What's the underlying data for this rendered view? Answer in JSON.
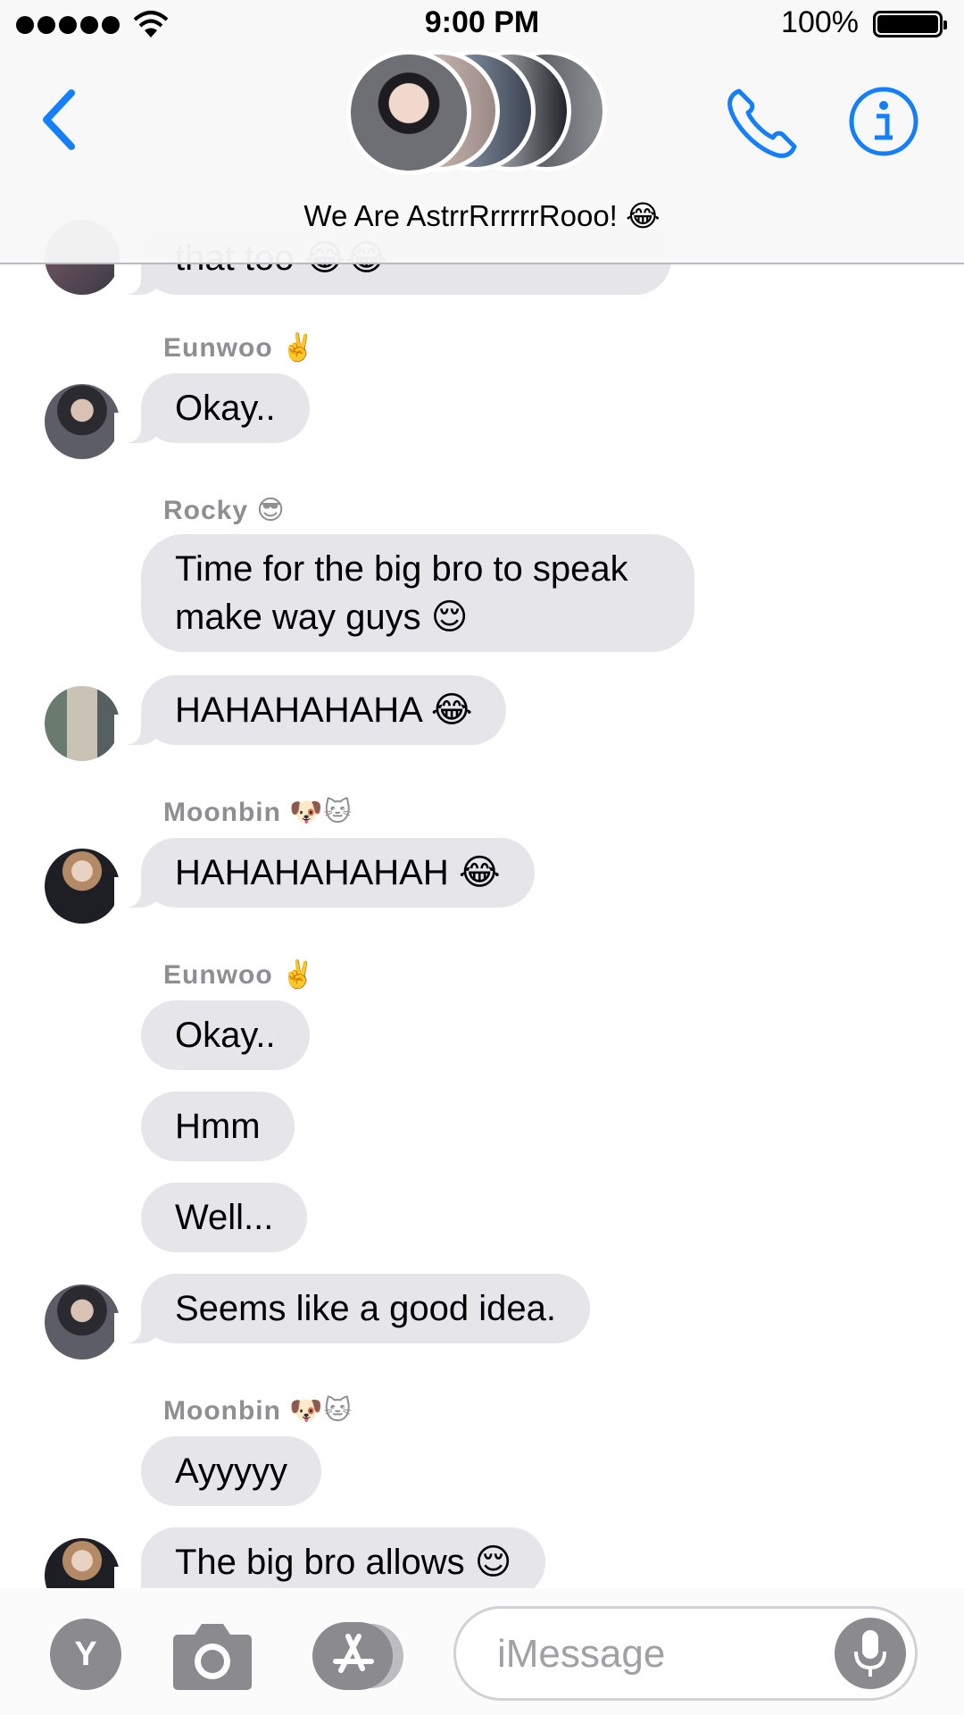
{
  "status_bar": {
    "time": "9:00 PM",
    "battery_percent": "100%"
  },
  "header": {
    "group_title": "We Are AstrrRrrrrrRooo! 😂"
  },
  "accent_color": "#147efb",
  "messages": {
    "top_partial": "that too 😂😂",
    "sender_1": "Eunwoo ✌️",
    "msg_1": "Okay..",
    "sender_2": "Rocky 😎",
    "msg_2": "Time for the big bro to speak make way guys 😌",
    "msg_3": "HAHAHAHAHA 😂",
    "sender_3": "Moonbin 🐶🐱",
    "msg_4": "HAHAHAHAHAH 😂",
    "sender_4": "Eunwoo ✌️",
    "msg_5": "Okay..",
    "msg_6": "Hmm",
    "msg_7": "Well...",
    "msg_8": "Seems like a good idea.",
    "sender_5": "Moonbin 🐶🐱",
    "msg_9": "Ayyyyy",
    "msg_10": "The big bro allows 😌"
  },
  "bottom_bar": {
    "tool_letter": "Y",
    "input_placeholder": "iMessage"
  }
}
